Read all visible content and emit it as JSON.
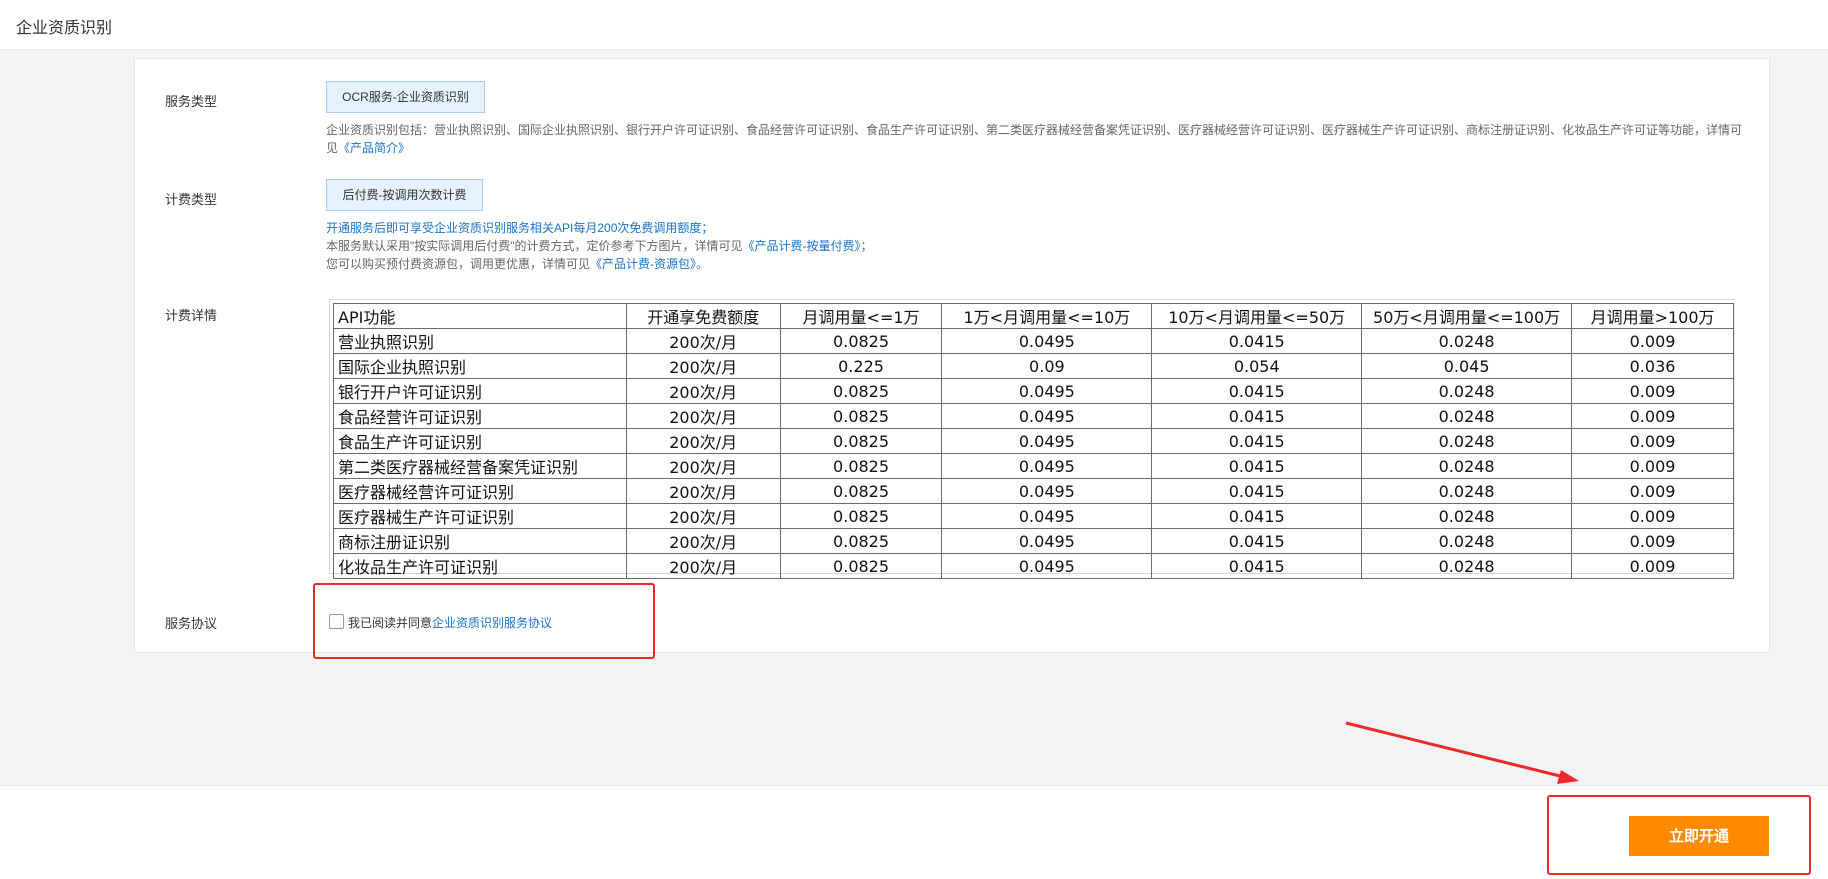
{
  "header": {
    "title": "企业资质识别"
  },
  "service_type": {
    "label": "服务类型",
    "value": "OCR服务-企业资质识别",
    "desc_prefix": "企业资质识别包括：营业执照识别、国际企业执照识别、银行开户许可证识别、食品经营许可证识别、食品生产许可证识别、第二类医疗器械经营备案凭证识别、医疗器械经营许可证识别、医疗器械生产许可证识别、商标注册证识别、化妆品生产许可证等功能，详情可见",
    "desc_link": "《产品简介》"
  },
  "billing_type": {
    "label": "计费类型",
    "value": "后付费-按调用次数计费",
    "note": "开通服务后即可享受企业资质识别服务相关API每月200次免费调用额度；",
    "line2_prefix": "本服务默认采用\"按实际调用后付费\"的计费方式，定价参考下方图片，详情可见",
    "line2_link": "《产品计费-按量付费》",
    "line2_suffix": "；",
    "line3_prefix": "您可以购买预付费资源包，调用更优惠，详情可见",
    "line3_link": "《产品计费-资源包》",
    "line3_suffix": "。"
  },
  "billing_detail": {
    "label": "计费详情",
    "columns": [
      "API功能",
      "开通享免费额度",
      "月调用量<=1万",
      "1万<月调用量<=10万",
      "10万<月调用量<=50万",
      "50万<月调用量<=100万",
      "月调用量>100万"
    ],
    "rows": [
      [
        "营业执照识别",
        "200次/月",
        "0.0825",
        "0.0495",
        "0.0415",
        "0.0248",
        "0.009"
      ],
      [
        "国际企业执照识别",
        "200次/月",
        "0.225",
        "0.09",
        "0.054",
        "0.045",
        "0.036"
      ],
      [
        "银行开户许可证识别",
        "200次/月",
        "0.0825",
        "0.0495",
        "0.0415",
        "0.0248",
        "0.009"
      ],
      [
        "食品经营许可证识别",
        "200次/月",
        "0.0825",
        "0.0495",
        "0.0415",
        "0.0248",
        "0.009"
      ],
      [
        "食品生产许可证识别",
        "200次/月",
        "0.0825",
        "0.0495",
        "0.0415",
        "0.0248",
        "0.009"
      ],
      [
        "第二类医疗器械经营备案凭证识别",
        "200次/月",
        "0.0825",
        "0.0495",
        "0.0415",
        "0.0248",
        "0.009"
      ],
      [
        "医疗器械经营许可证识别",
        "200次/月",
        "0.0825",
        "0.0495",
        "0.0415",
        "0.0248",
        "0.009"
      ],
      [
        "医疗器械生产许可证识别",
        "200次/月",
        "0.0825",
        "0.0495",
        "0.0415",
        "0.0248",
        "0.009"
      ],
      [
        "商标注册证识别",
        "200次/月",
        "0.0825",
        "0.0495",
        "0.0415",
        "0.0248",
        "0.009"
      ],
      [
        "化妆品生产许可证识别",
        "200次/月",
        "0.0825",
        "0.0495",
        "0.0415",
        "0.0248",
        "0.009"
      ]
    ]
  },
  "agreement": {
    "label": "服务协议",
    "text": "我已阅读并同意",
    "link": "企业资质识别服务协议",
    "checked": false
  },
  "footer": {
    "open_label": "立即开通"
  },
  "colors": {
    "accent": "#ff8a00",
    "link": "#1a73c9",
    "highlight": "#f0262a"
  }
}
